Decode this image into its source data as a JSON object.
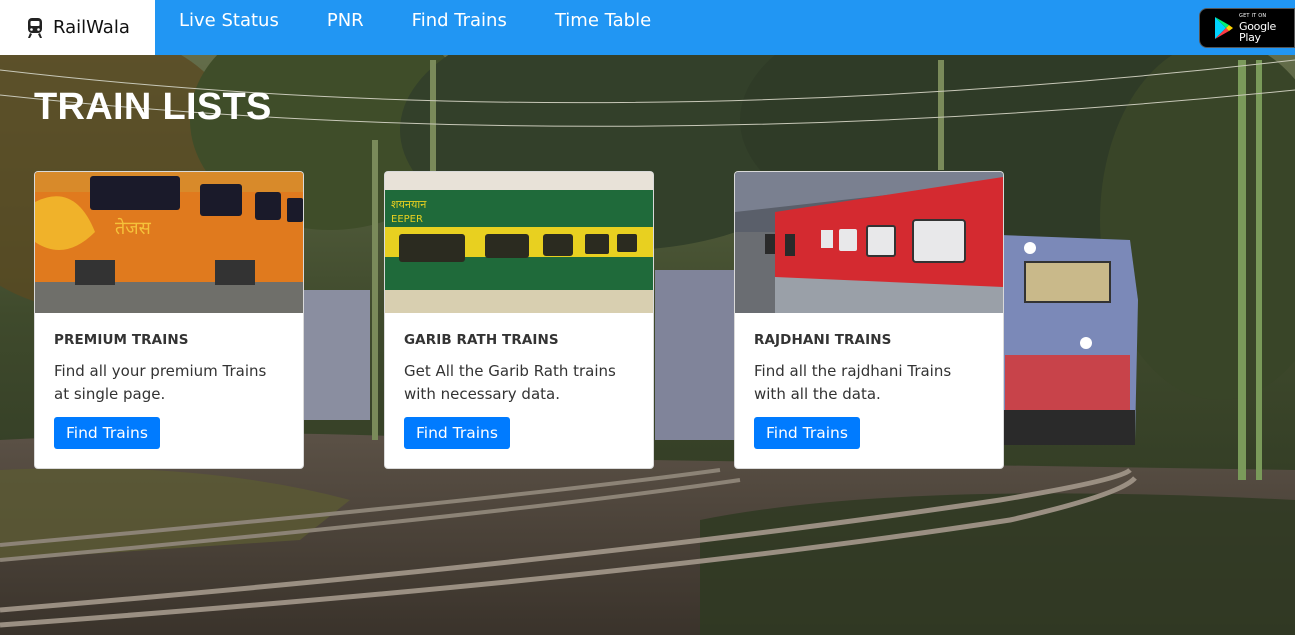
{
  "navbar": {
    "brand": "RailWala",
    "links": [
      "Live Status",
      "PNR",
      "Find Trains",
      "Time Table"
    ],
    "play_badge": {
      "small": "GET IT ON",
      "big": "Google Play"
    }
  },
  "main": {
    "title": "TRAIN LISTS",
    "cards": [
      {
        "title": "PREMIUM TRAINS",
        "text": "Find all your premium Trains at single page.",
        "button": "Find Trains"
      },
      {
        "title": "GARIB RATH TRAINS",
        "text": "Get All the Garib Rath trains with necessary data.",
        "button": "Find Trains"
      },
      {
        "title": "RAJDHANI TRAINS",
        "text": "Find all the rajdhani Trains with all the data.",
        "button": "Find Trains"
      }
    ]
  },
  "icons": {
    "brand": "train-icon",
    "play": "google-play-icon"
  },
  "colors": {
    "navbar": "#2196f3",
    "button": "#007bff"
  }
}
